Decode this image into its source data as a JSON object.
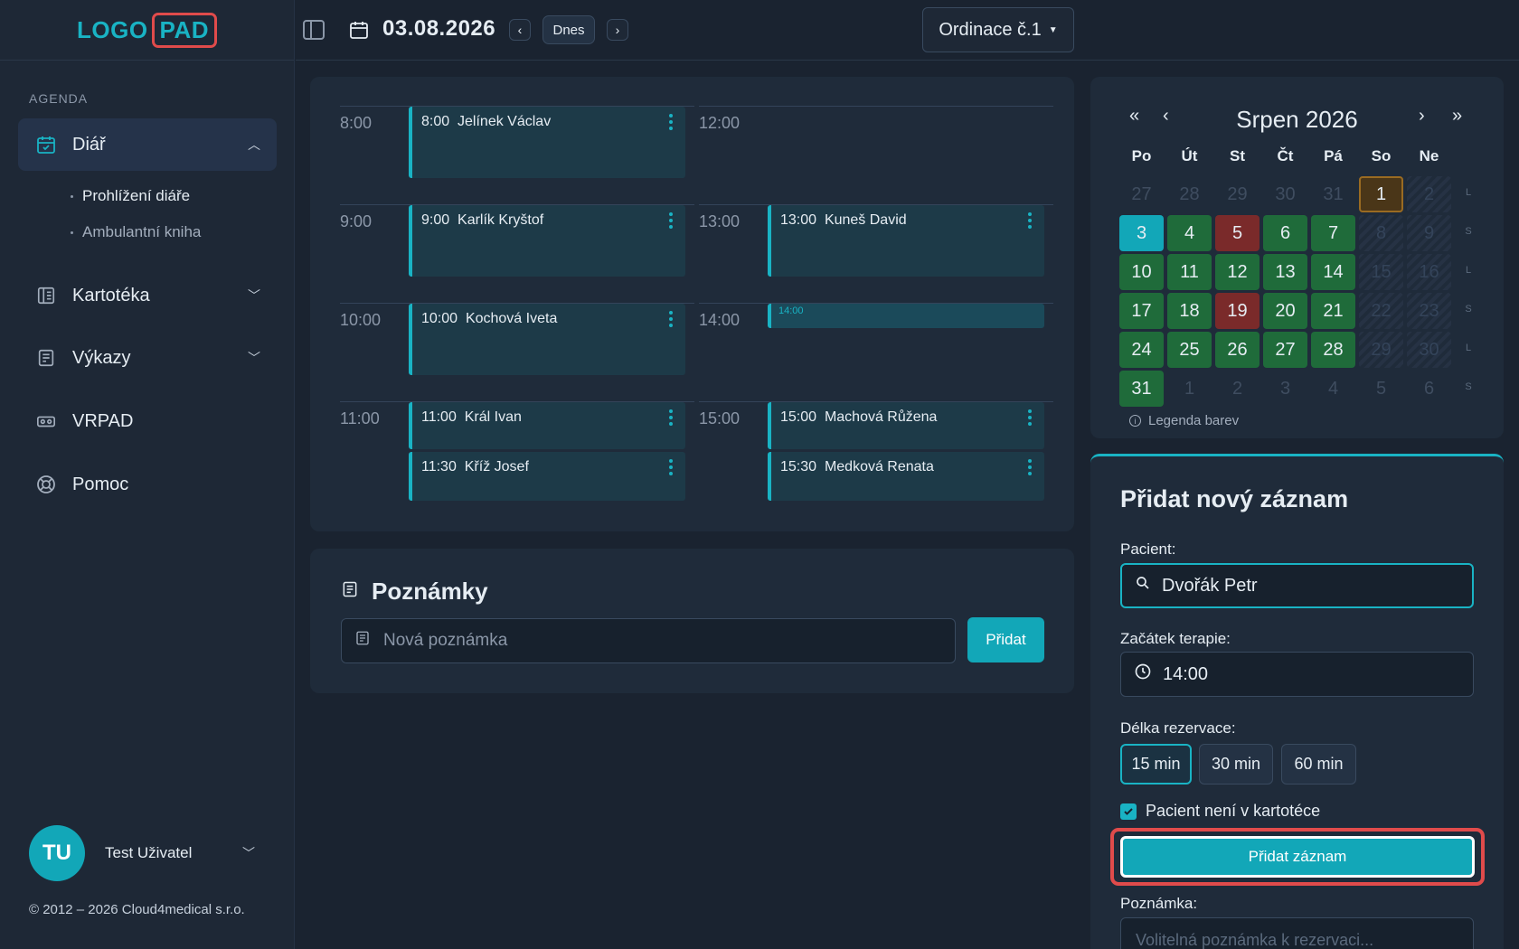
{
  "logo": {
    "part1": "LOGO",
    "part2": "PAD"
  },
  "sidebar": {
    "section": "AGENDA",
    "items": [
      {
        "label": "Diář",
        "icon": "calendar-check-icon"
      },
      {
        "label": "Kartotéka",
        "icon": "book-icon"
      },
      {
        "label": "Výkazy",
        "icon": "report-icon"
      },
      {
        "label": "VRPAD",
        "icon": "vr-headset-icon"
      },
      {
        "label": "Pomoc",
        "icon": "lifebuoy-icon"
      }
    ],
    "subitems": [
      "Prohlížení diáře",
      "Ambulantní kniha"
    ],
    "user": {
      "initials": "TU",
      "name": "Test Uživatel"
    },
    "copyright": "© 2012 – 2026 Cloud4medical s.r.o."
  },
  "topbar": {
    "date": "03.08.2026",
    "today_label": "Dnes",
    "room": "Ordinace č.1"
  },
  "schedule": {
    "left_times": [
      "8:00",
      "9:00",
      "10:00",
      "11:00"
    ],
    "right_times": [
      "12:00",
      "13:00",
      "14:00",
      "15:00"
    ],
    "appointments": {
      "a1": {
        "time": "8:00",
        "name": "Jelínek Václav"
      },
      "a2": {
        "time": "9:00",
        "name": "Karlík Kryštof"
      },
      "a3": {
        "time": "10:00",
        "name": "Kochová Iveta"
      },
      "a4": {
        "time": "11:00",
        "name": "Král Ivan"
      },
      "a5": {
        "time": "11:30",
        "name": "Kříž Josef"
      },
      "a6": {
        "time": "13:00",
        "name": "Kuneš David"
      },
      "a7": {
        "time": "15:00",
        "name": "Machová Růžena"
      },
      "a8": {
        "time": "15:30",
        "name": "Medková Renata"
      }
    },
    "new_slot": "14:00"
  },
  "notes": {
    "title": "Poznámky",
    "placeholder": "Nová poznámka",
    "add_label": "Přidat"
  },
  "calendar": {
    "title": "Srpen 2026",
    "nav": {
      "first": "«",
      "prev": "‹",
      "next": "›",
      "last": "»"
    },
    "weekdays": [
      "Po",
      "Út",
      "St",
      "Čt",
      "Pá",
      "So",
      "Ne"
    ],
    "side_letters": [
      "L",
      "S",
      "L",
      "S",
      "L",
      "S"
    ],
    "weeks": [
      [
        {
          "d": "27",
          "s": "out"
        },
        {
          "d": "28",
          "s": "out"
        },
        {
          "d": "29",
          "s": "out"
        },
        {
          "d": "30",
          "s": "out"
        },
        {
          "d": "31",
          "s": "out"
        },
        {
          "d": "1",
          "s": "sel"
        },
        {
          "d": "2",
          "s": "hatch"
        }
      ],
      [
        {
          "d": "3",
          "s": "today"
        },
        {
          "d": "4",
          "s": "green"
        },
        {
          "d": "5",
          "s": "red"
        },
        {
          "d": "6",
          "s": "green"
        },
        {
          "d": "7",
          "s": "green"
        },
        {
          "d": "8",
          "s": "hatch"
        },
        {
          "d": "9",
          "s": "hatch"
        }
      ],
      [
        {
          "d": "10",
          "s": "green"
        },
        {
          "d": "11",
          "s": "green"
        },
        {
          "d": "12",
          "s": "green"
        },
        {
          "d": "13",
          "s": "green"
        },
        {
          "d": "14",
          "s": "green"
        },
        {
          "d": "15",
          "s": "hatch"
        },
        {
          "d": "16",
          "s": "hatch"
        }
      ],
      [
        {
          "d": "17",
          "s": "green"
        },
        {
          "d": "18",
          "s": "green"
        },
        {
          "d": "19",
          "s": "red"
        },
        {
          "d": "20",
          "s": "green"
        },
        {
          "d": "21",
          "s": "green"
        },
        {
          "d": "22",
          "s": "hatch"
        },
        {
          "d": "23",
          "s": "hatch"
        }
      ],
      [
        {
          "d": "24",
          "s": "green"
        },
        {
          "d": "25",
          "s": "green"
        },
        {
          "d": "26",
          "s": "green"
        },
        {
          "d": "27",
          "s": "green"
        },
        {
          "d": "28",
          "s": "green"
        },
        {
          "d": "29",
          "s": "hatch"
        },
        {
          "d": "30",
          "s": "hatch"
        }
      ],
      [
        {
          "d": "31",
          "s": "green"
        },
        {
          "d": "1",
          "s": "out"
        },
        {
          "d": "2",
          "s": "out"
        },
        {
          "d": "3",
          "s": "out"
        },
        {
          "d": "4",
          "s": "out"
        },
        {
          "d": "5",
          "s": "out"
        },
        {
          "d": "6",
          "s": "out"
        }
      ]
    ],
    "legend": "Legenda barev"
  },
  "form": {
    "title": "Přidat nový záznam",
    "patient_label": "Pacient:",
    "patient_value": "Dvořák Petr",
    "start_label": "Začátek terapie:",
    "start_value": "14:00",
    "duration_label": "Délka rezervace:",
    "durations": [
      "15 min",
      "30 min",
      "60 min"
    ],
    "checkbox_label": "Pacient není v kartotéce",
    "submit_label": "Přidat záznam",
    "note_label": "Poznámka:",
    "note_placeholder": "Volitelná poznámka k rezervaci..."
  },
  "colors": {
    "accent": "#19b3c4",
    "green": "#1f6b3a",
    "red": "#7a2a2a",
    "highlight": "#e04b4b"
  }
}
